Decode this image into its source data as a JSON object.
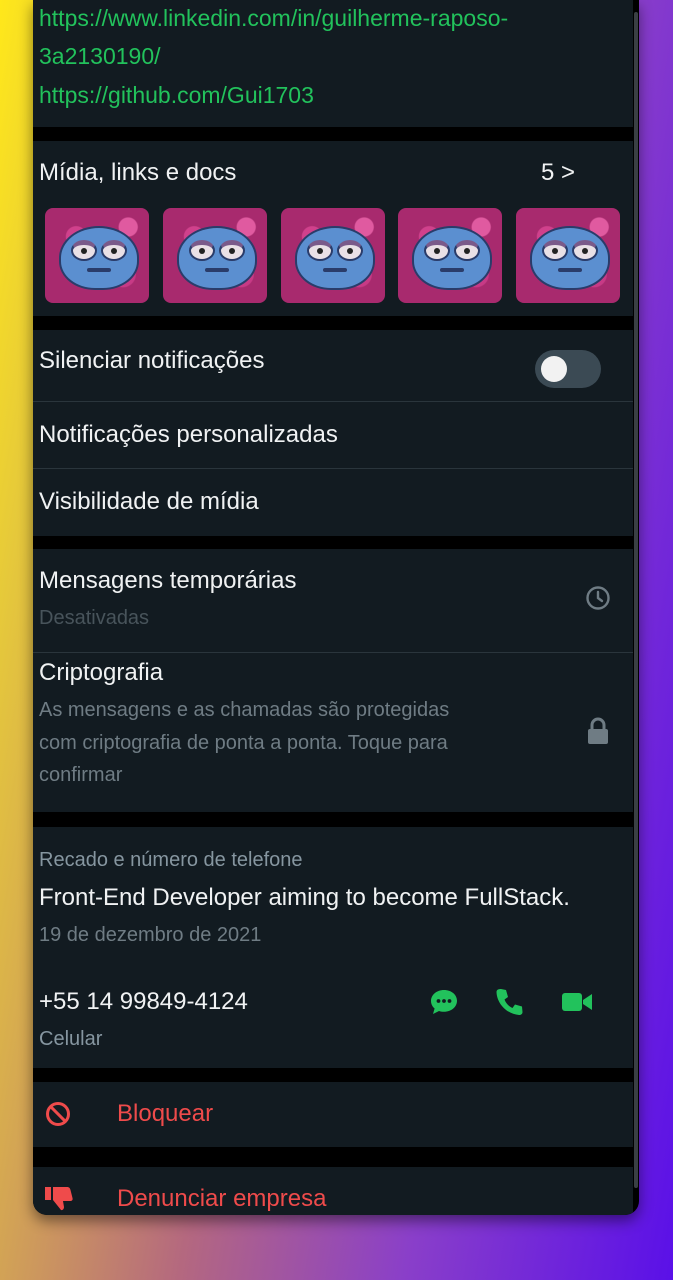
{
  "about": {
    "linkedin": "https://www.linkedin.com/in/guilherme-raposo-",
    "linkedin_cont": "3a2130190/",
    "github": "https://github.com/Gui1703"
  },
  "media": {
    "title": "Mídia, links e docs",
    "count": "5 >"
  },
  "settings": {
    "mute": "Silenciar notificações",
    "mute_on": false,
    "custom_notifications": "Notificações personalizadas",
    "media_visibility": "Visibilidade de mídia"
  },
  "privacy": {
    "temp_title": "Mensagens temporárias",
    "temp_status": "Desativadas",
    "crypto_title": "Criptografia",
    "crypto_line1": "As mensagens e as chamadas são protegidas",
    "crypto_line2": "com criptografia de ponta a ponta. Toque para",
    "crypto_line3": "confirmar"
  },
  "status": {
    "label": "Recado e número de telefone",
    "text": "Front-End Developer aiming to become FullStack.",
    "date": "19 de dezembro de 2021",
    "phone": "+55 14 99849-4124",
    "phone_type": "Celular"
  },
  "actions": {
    "block": "Bloquear",
    "report": "Denunciar empresa"
  },
  "colors": {
    "accent": "#22c25c",
    "danger": "#ef4b4b",
    "background": "#121b21"
  }
}
